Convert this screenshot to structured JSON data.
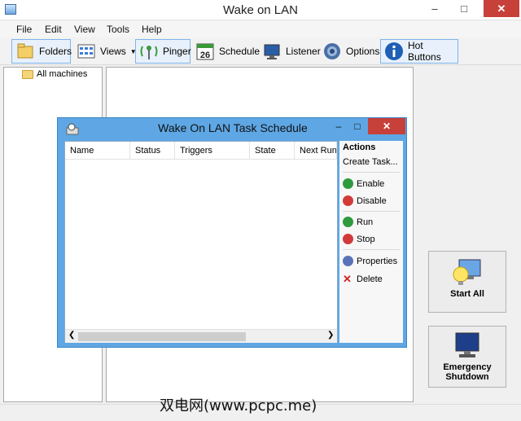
{
  "window": {
    "title": "Wake on LAN"
  },
  "menu": [
    "File",
    "Edit",
    "View",
    "Tools",
    "Help"
  ],
  "toolbar": {
    "folders": "Folders",
    "views": "Views",
    "pinger": "Pinger",
    "schedule": "Schedule",
    "schedule_day": "26",
    "listener": "Listener",
    "options": "Options",
    "hot_buttons": "Hot Buttons"
  },
  "tree": {
    "root": "All machines"
  },
  "buttons": {
    "start_all": "Start All",
    "emergency": "Emergency",
    "shutdown": "Shutdown"
  },
  "dialog": {
    "title": "Wake On LAN Task Schedule",
    "columns": [
      "Name",
      "Status",
      "Triggers",
      "State",
      "Next Run T"
    ],
    "actions_header": "Actions",
    "actions": {
      "create": "Create Task...",
      "enable": "Enable",
      "disable": "Disable",
      "run": "Run",
      "stop": "Stop",
      "properties": "Properties",
      "delete": "Delete"
    }
  },
  "watermark": "双电网(www.pcpc.me)"
}
